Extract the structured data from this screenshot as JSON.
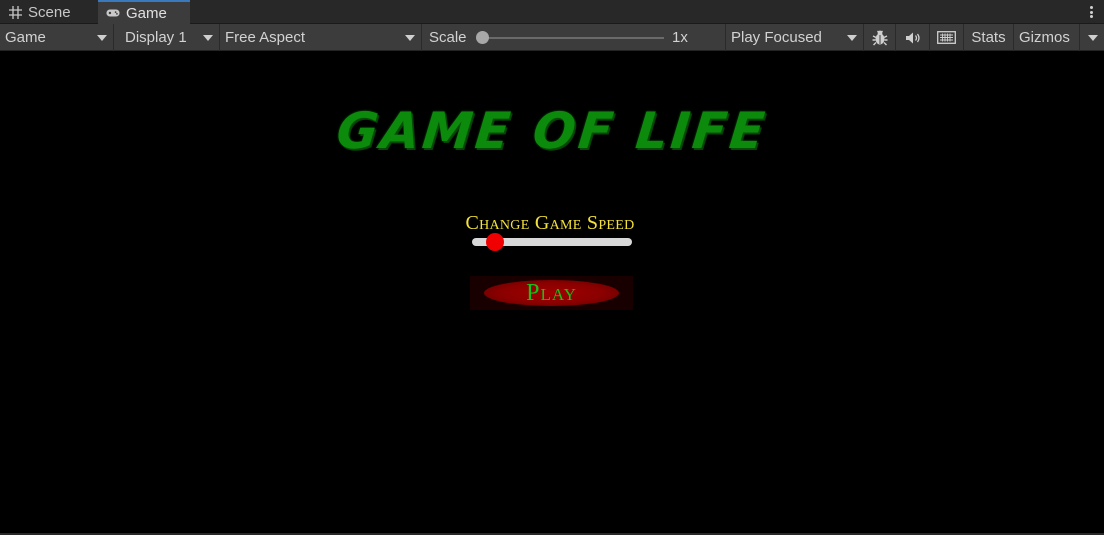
{
  "tabs": [
    {
      "label": "Scene",
      "icon": "grid-icon",
      "active": false
    },
    {
      "label": "Game",
      "icon": "gamepad-icon",
      "active": true
    }
  ],
  "toolbar": {
    "game_select": "Game",
    "display_select": "Display 1",
    "aspect_select": "Free Aspect",
    "scale_label": "Scale",
    "scale_value": "1x",
    "play_mode_select": "Play Focused",
    "stats_label": "Stats",
    "gizmos_label": "Gizmos"
  },
  "game": {
    "title": "GAME OF LIFE",
    "speed_label": "Change Game Speed",
    "speed_slider_fraction": 0.1,
    "play_label": "Play"
  },
  "colors": {
    "title_green": "#0c8a0c",
    "label_yellow": "#f2e23a",
    "slider_knob_red": "#f00000",
    "play_bg_red": "#8a0000",
    "play_text_green": "#18c018",
    "tab_accent": "#3a79bb"
  }
}
